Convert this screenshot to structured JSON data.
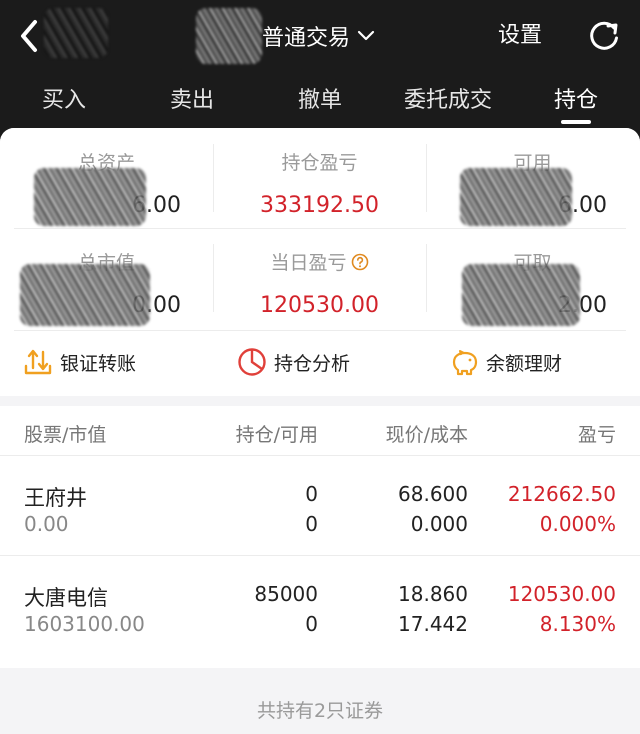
{
  "topbar": {
    "title": "普通交易",
    "settings_label": "设置",
    "back_icon": "chevron-left-icon",
    "dropdown_icon": "chevron-down-icon",
    "refresh_icon": "refresh-icon"
  },
  "tabs": [
    {
      "label": "买入"
    },
    {
      "label": "卖出"
    },
    {
      "label": "撤单"
    },
    {
      "label": "委托成交"
    },
    {
      "label": "持仓",
      "active": true
    }
  ],
  "summary": {
    "total_assets": {
      "label": "总资产",
      "value_visible": "6.00"
    },
    "position_pnl": {
      "label": "持仓盈亏",
      "value": "333192.50"
    },
    "available": {
      "label": "可用",
      "value_visible": "6.00"
    },
    "market_value": {
      "label": "总市值",
      "value_visible": "0.00"
    },
    "daily_pnl": {
      "label": "当日盈亏",
      "value": "120530.00",
      "help_icon": "question-circle-icon"
    },
    "withdrawable": {
      "label": "可取",
      "value_visible": "2.00"
    }
  },
  "actions": [
    {
      "label": "银证转账",
      "icon": "transfer-icon"
    },
    {
      "label": "持仓分析",
      "icon": "pie-chart-icon"
    },
    {
      "label": "余额理财",
      "icon": "piggy-bank-icon"
    }
  ],
  "table": {
    "headers": [
      "股票/市值",
      "持仓/可用",
      "现价/成本",
      "盈亏"
    ],
    "rows": [
      {
        "name": "王府井",
        "market_value": "0.00",
        "position": "0",
        "available": "0",
        "price": "68.600",
        "cost": "0.000",
        "pnl": "212662.50",
        "pnl_pct": "0.000%"
      },
      {
        "name": "大唐电信",
        "market_value": "1603100.00",
        "position": "85000",
        "available": "0",
        "price": "18.860",
        "cost": "17.442",
        "pnl": "120530.00",
        "pnl_pct": "8.130%"
      }
    ]
  },
  "footer": "共持有2只证券",
  "colors": {
    "accent_red": "#d2222a",
    "icon_orange": "#f0a020",
    "icon_red": "#e0403a",
    "dark_bg": "#1b1b1b"
  }
}
